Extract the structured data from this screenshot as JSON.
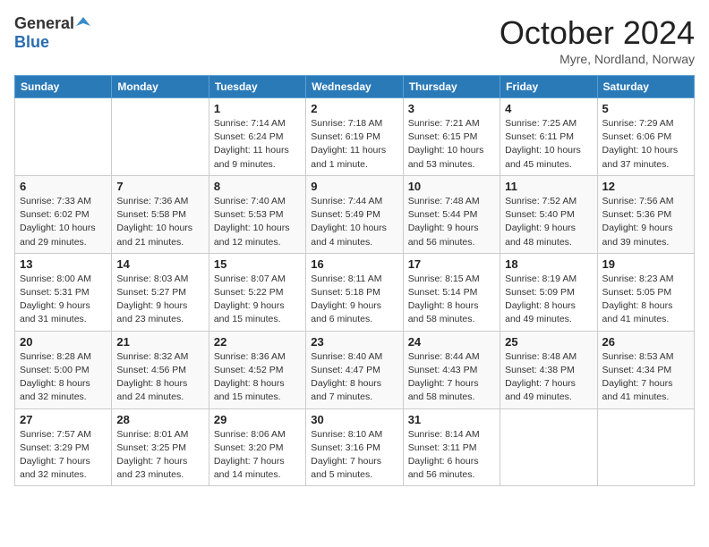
{
  "header": {
    "logo_general": "General",
    "logo_blue": "Blue",
    "month_title": "October 2024",
    "location": "Myre, Nordland, Norway"
  },
  "weekdays": [
    "Sunday",
    "Monday",
    "Tuesday",
    "Wednesday",
    "Thursday",
    "Friday",
    "Saturday"
  ],
  "weeks": [
    [
      {
        "day": "",
        "info": ""
      },
      {
        "day": "",
        "info": ""
      },
      {
        "day": "1",
        "info": "Sunrise: 7:14 AM\nSunset: 6:24 PM\nDaylight: 11 hours and 9 minutes."
      },
      {
        "day": "2",
        "info": "Sunrise: 7:18 AM\nSunset: 6:19 PM\nDaylight: 11 hours and 1 minute."
      },
      {
        "day": "3",
        "info": "Sunrise: 7:21 AM\nSunset: 6:15 PM\nDaylight: 10 hours and 53 minutes."
      },
      {
        "day": "4",
        "info": "Sunrise: 7:25 AM\nSunset: 6:11 PM\nDaylight: 10 hours and 45 minutes."
      },
      {
        "day": "5",
        "info": "Sunrise: 7:29 AM\nSunset: 6:06 PM\nDaylight: 10 hours and 37 minutes."
      }
    ],
    [
      {
        "day": "6",
        "info": "Sunrise: 7:33 AM\nSunset: 6:02 PM\nDaylight: 10 hours and 29 minutes."
      },
      {
        "day": "7",
        "info": "Sunrise: 7:36 AM\nSunset: 5:58 PM\nDaylight: 10 hours and 21 minutes."
      },
      {
        "day": "8",
        "info": "Sunrise: 7:40 AM\nSunset: 5:53 PM\nDaylight: 10 hours and 12 minutes."
      },
      {
        "day": "9",
        "info": "Sunrise: 7:44 AM\nSunset: 5:49 PM\nDaylight: 10 hours and 4 minutes."
      },
      {
        "day": "10",
        "info": "Sunrise: 7:48 AM\nSunset: 5:44 PM\nDaylight: 9 hours and 56 minutes."
      },
      {
        "day": "11",
        "info": "Sunrise: 7:52 AM\nSunset: 5:40 PM\nDaylight: 9 hours and 48 minutes."
      },
      {
        "day": "12",
        "info": "Sunrise: 7:56 AM\nSunset: 5:36 PM\nDaylight: 9 hours and 39 minutes."
      }
    ],
    [
      {
        "day": "13",
        "info": "Sunrise: 8:00 AM\nSunset: 5:31 PM\nDaylight: 9 hours and 31 minutes."
      },
      {
        "day": "14",
        "info": "Sunrise: 8:03 AM\nSunset: 5:27 PM\nDaylight: 9 hours and 23 minutes."
      },
      {
        "day": "15",
        "info": "Sunrise: 8:07 AM\nSunset: 5:22 PM\nDaylight: 9 hours and 15 minutes."
      },
      {
        "day": "16",
        "info": "Sunrise: 8:11 AM\nSunset: 5:18 PM\nDaylight: 9 hours and 6 minutes."
      },
      {
        "day": "17",
        "info": "Sunrise: 8:15 AM\nSunset: 5:14 PM\nDaylight: 8 hours and 58 minutes."
      },
      {
        "day": "18",
        "info": "Sunrise: 8:19 AM\nSunset: 5:09 PM\nDaylight: 8 hours and 49 minutes."
      },
      {
        "day": "19",
        "info": "Sunrise: 8:23 AM\nSunset: 5:05 PM\nDaylight: 8 hours and 41 minutes."
      }
    ],
    [
      {
        "day": "20",
        "info": "Sunrise: 8:28 AM\nSunset: 5:00 PM\nDaylight: 8 hours and 32 minutes."
      },
      {
        "day": "21",
        "info": "Sunrise: 8:32 AM\nSunset: 4:56 PM\nDaylight: 8 hours and 24 minutes."
      },
      {
        "day": "22",
        "info": "Sunrise: 8:36 AM\nSunset: 4:52 PM\nDaylight: 8 hours and 15 minutes."
      },
      {
        "day": "23",
        "info": "Sunrise: 8:40 AM\nSunset: 4:47 PM\nDaylight: 8 hours and 7 minutes."
      },
      {
        "day": "24",
        "info": "Sunrise: 8:44 AM\nSunset: 4:43 PM\nDaylight: 7 hours and 58 minutes."
      },
      {
        "day": "25",
        "info": "Sunrise: 8:48 AM\nSunset: 4:38 PM\nDaylight: 7 hours and 49 minutes."
      },
      {
        "day": "26",
        "info": "Sunrise: 8:53 AM\nSunset: 4:34 PM\nDaylight: 7 hours and 41 minutes."
      }
    ],
    [
      {
        "day": "27",
        "info": "Sunrise: 7:57 AM\nSunset: 3:29 PM\nDaylight: 7 hours and 32 minutes."
      },
      {
        "day": "28",
        "info": "Sunrise: 8:01 AM\nSunset: 3:25 PM\nDaylight: 7 hours and 23 minutes."
      },
      {
        "day": "29",
        "info": "Sunrise: 8:06 AM\nSunset: 3:20 PM\nDaylight: 7 hours and 14 minutes."
      },
      {
        "day": "30",
        "info": "Sunrise: 8:10 AM\nSunset: 3:16 PM\nDaylight: 7 hours and 5 minutes."
      },
      {
        "day": "31",
        "info": "Sunrise: 8:14 AM\nSunset: 3:11 PM\nDaylight: 6 hours and 56 minutes."
      },
      {
        "day": "",
        "info": ""
      },
      {
        "day": "",
        "info": ""
      }
    ]
  ]
}
